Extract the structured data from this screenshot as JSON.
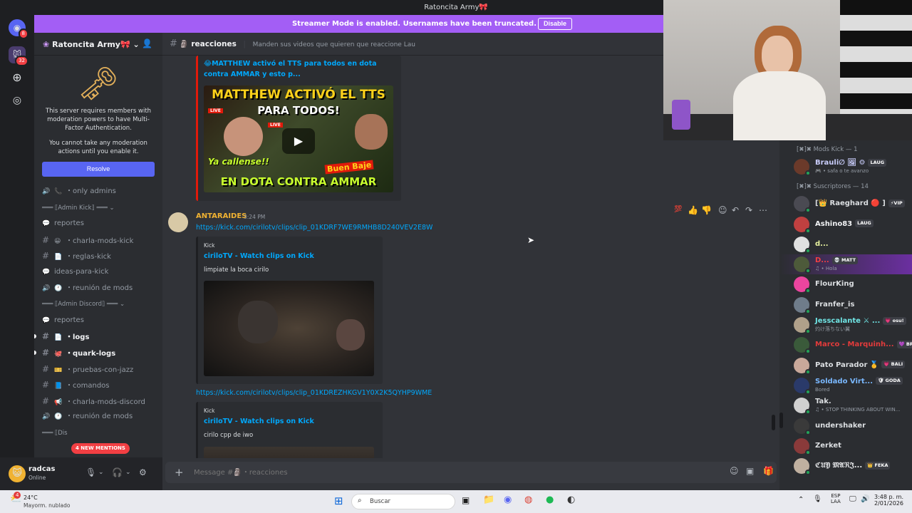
{
  "window": {
    "title": "Ratoncita Army🎀"
  },
  "rail": {
    "home_badge": "8",
    "server_badge": "32"
  },
  "banner": {
    "text": "Streamer Mode is enabled. Usernames have been truncated.",
    "button": "Disable"
  },
  "server": {
    "name": "Ratoncita Army🎀"
  },
  "mfa": {
    "line1": "This server requires members with moderation powers to have Multi-Factor Authentication.",
    "line2": "You cannot take any moderation actions until you enable it.",
    "button": "Resolve"
  },
  "sidebar": {
    "items": [
      {
        "kind": "voice",
        "emoji": "📞",
        "label": "only admins"
      },
      {
        "kind": "cat",
        "label": "═══ ⟦Admin Kick⟧ ═══ ⌄"
      },
      {
        "kind": "forum",
        "emoji": "",
        "label": "reportes"
      },
      {
        "kind": "text",
        "emoji": "😀",
        "label": "charla-mods-kick"
      },
      {
        "kind": "text",
        "emoji": "📄",
        "label": "reglas-kick"
      },
      {
        "kind": "forum",
        "emoji": "",
        "label": "ideas-para-kick"
      },
      {
        "kind": "voice",
        "emoji": "🕐",
        "label": "reunión de mods"
      },
      {
        "kind": "cat",
        "label": "═══ ⟦Admin Discord⟧ ═══ ⌄"
      },
      {
        "kind": "forum",
        "emoji": "",
        "label": "reportes"
      },
      {
        "kind": "text",
        "emoji": "📄",
        "label": "logs",
        "unread": true
      },
      {
        "kind": "text",
        "emoji": "🐙",
        "label": "quark-logs",
        "unread": true
      },
      {
        "kind": "text",
        "emoji": "🎫",
        "label": "pruebas-con-jazz"
      },
      {
        "kind": "text",
        "emoji": "📘",
        "label": "comandos"
      },
      {
        "kind": "text",
        "emoji": "📢",
        "label": "charla-mods-discord"
      },
      {
        "kind": "voice",
        "emoji": "🕐",
        "label": "reunión de mods"
      }
    ],
    "mentions_badge": "4 NEW MENTIONS",
    "partial_cat": "═══ ⟦Dis"
  },
  "user": {
    "name": "radcas",
    "status": "Online"
  },
  "channel": {
    "name": "reacciones",
    "topic": "Manden sus videos que quieren que reaccione Lau"
  },
  "messages": {
    "embed1": {
      "title": "😂MATTHEW activó el TTS para todos en dota contra AMMAR y esto p...",
      "thumb_line1": "MATTHEW ACTIVÓ EL TTS",
      "thumb_line2": "PARA TODOS!",
      "thumb_line3": "EN DOTA CONTRA AMMAR",
      "thumb_callout1": "Ya callense!!",
      "thumb_callout2": "Buen Baje",
      "thumb_live1": "LIVE",
      "thumb_live2": "LIVE"
    },
    "msg2": {
      "author": "ANTARAIDES",
      "time": "3:24 PM",
      "link1": "https://kick.com/cirilotv/clips/clip_01KDRF7WE9RMHB8D240VEV2E8W",
      "embed1_provider": "Kick",
      "embed1_title": "ciriloTV - Watch clips on Kick",
      "embed1_desc": "limpiate la boca cirilo",
      "link2": "https://kick.com/cirilotv/clips/clip_01KDREZHKGV1Y0X2K5QYHP9WME",
      "embed2_provider": "Kick",
      "embed2_title": "ciriloTV - Watch clips on Kick",
      "embed2_desc": "cirilo cpp de iwo"
    }
  },
  "composer": {
    "placeholder": "Message #🗿・reacciones"
  },
  "members": {
    "groups": [
      {
        "title": "[✖]✖ Mods Kick — 1",
        "members": [
          {
            "name": "Brauli∅ 🖼 ⚙",
            "tag": "LAUG",
            "sub": "🎮 • safa o te avanzo",
            "color": "#c9cdfb"
          }
        ]
      },
      {
        "title": "[✖]✖ Suscriptores — 14",
        "members": [
          {
            "name": "[👑 Raeghard 🔴 ]",
            "tag": "⚡VIP",
            "sub": "",
            "color": "#dbdee1"
          },
          {
            "name": "Ashino83",
            "tag": "LAUG",
            "sub": "",
            "color": "#f2f3f5"
          },
          {
            "name": "d...",
            "tag": "",
            "sub": "",
            "color": "#e9f4a0"
          },
          {
            "name": "D...",
            "tag": "💀 MATT",
            "sub": "♫ • Hola",
            "color": "#f23f43"
          },
          {
            "name": "FlourKing",
            "tag": "",
            "sub": "",
            "color": "#dbdee1"
          },
          {
            "name": "Franfer_is",
            "tag": "",
            "sub": "",
            "color": "#dbdee1"
          },
          {
            "name": "Jesscalante ⚔ ...",
            "tag": "💗 osu!",
            "sub": "灼け落ちない翼",
            "color": "#6fe4e4"
          },
          {
            "name": "Marco - Marquinh...",
            "tag": "💜 BRR",
            "sub": "",
            "color": "#e33b3b"
          },
          {
            "name": "Pato Parador 🥇",
            "tag": "💗 BALI",
            "sub": "",
            "color": "#dbdee1"
          },
          {
            "name": "Soldado Virt...",
            "tag": "🛡 GODA",
            "sub": "Bored",
            "color": "#7ab8ff"
          },
          {
            "name": "Tak.",
            "tag": "",
            "sub": "♫ • STOP THINKING ABOUT WIN...",
            "color": "#dbdee1"
          },
          {
            "name": "undershaker",
            "tag": "",
            "sub": "",
            "color": "#dbdee1"
          },
          {
            "name": "Zerket",
            "tag": "",
            "sub": "",
            "color": "#dbdee1"
          },
          {
            "name": "ℭ𝔘𝔜 𝔐𝔄ℜ𝔍...",
            "tag": "👑 FEKA",
            "sub": "",
            "color": "#f2f3f5"
          }
        ]
      }
    ]
  },
  "taskbar": {
    "weather_temp": "24°C",
    "weather_desc": "Mayorm. nublado",
    "weather_badge": "4",
    "search": "Buscar",
    "lang1": "ESP",
    "lang2": "LAA",
    "time": "3:48 p. m.",
    "date": "2/01/2026"
  },
  "colors": {
    "accent": "#5865f2",
    "banner": "#a35ef5",
    "link": "#00a8fc",
    "author": "#f0b232"
  }
}
